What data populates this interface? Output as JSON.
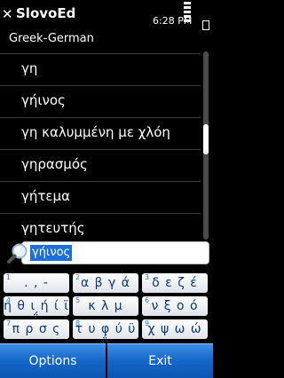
{
  "status": {
    "close_glyph": "✕",
    "app_title": "SlovoEd",
    "time": "6:28 PM"
  },
  "subtitle": "Greek-German",
  "list": {
    "items": [
      {
        "label": "γη"
      },
      {
        "label": "γήινος"
      },
      {
        "label": "γη καλυμμένη με χλόη"
      },
      {
        "label": "γηρασμός"
      },
      {
        "label": "γήτεμα"
      },
      {
        "label": "γητευτής"
      }
    ]
  },
  "search": {
    "value": "γήινος",
    "icon": "magnifier-icon"
  },
  "keypad": {
    "keys": [
      {
        "num": "1",
        "label": ". , -"
      },
      {
        "num": "2",
        "label": "α β γ ά"
      },
      {
        "num": "3",
        "label": "δ ε ζ έ"
      },
      {
        "num": "4",
        "label": "η θ ι ή ί ϊ ΐ"
      },
      {
        "num": "5",
        "label": "κ λ μ"
      },
      {
        "num": "6",
        "label": "ν ξ ο ό"
      },
      {
        "num": "7",
        "label": "π ρ σ ς"
      },
      {
        "num": "8",
        "label": "τ υ φ ύ ϋ ΰ"
      },
      {
        "num": "9",
        "label": "χ ψ ω ώ"
      }
    ]
  },
  "softkeys": {
    "left": "Options",
    "right": "Exit"
  },
  "colors": {
    "accent": "#1466c8",
    "selection": "#1b6fd6",
    "key_text": "#0a3a7a"
  }
}
